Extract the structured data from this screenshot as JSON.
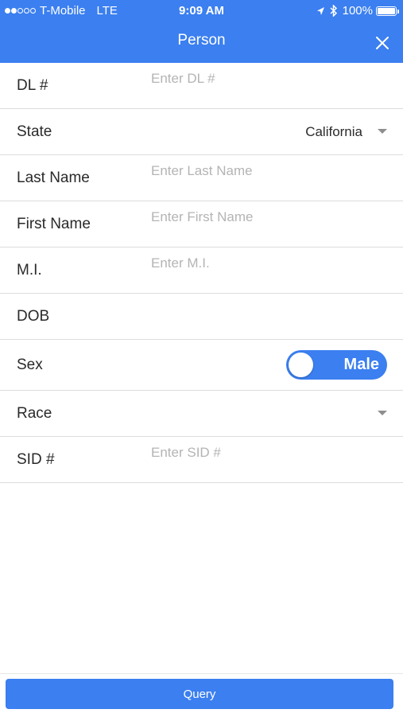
{
  "status_bar": {
    "carrier": "T-Mobile",
    "network": "LTE",
    "time": "9:09 AM",
    "battery": "100%",
    "signal_bars": 2,
    "signal_total": 5
  },
  "header": {
    "title": "Person",
    "close_icon": "close-icon"
  },
  "form": {
    "dl": {
      "label": "DL #",
      "placeholder": "Enter DL #"
    },
    "state": {
      "label": "State",
      "value": "California"
    },
    "last_name": {
      "label": "Last Name",
      "placeholder": "Enter Last Name"
    },
    "first_name": {
      "label": "First Name",
      "placeholder": "Enter First Name"
    },
    "mi": {
      "label": "M.I.",
      "placeholder": "Enter M.I."
    },
    "dob": {
      "label": "DOB"
    },
    "sex": {
      "label": "Sex",
      "value": "Male"
    },
    "race": {
      "label": "Race",
      "value": ""
    },
    "sid": {
      "label": "SID #",
      "placeholder": "Enter SID #"
    }
  },
  "footer": {
    "query_label": "Query"
  },
  "colors": {
    "accent": "#3b7ff0",
    "divider": "#dcdcdc",
    "placeholder": "#b4b4b4"
  }
}
